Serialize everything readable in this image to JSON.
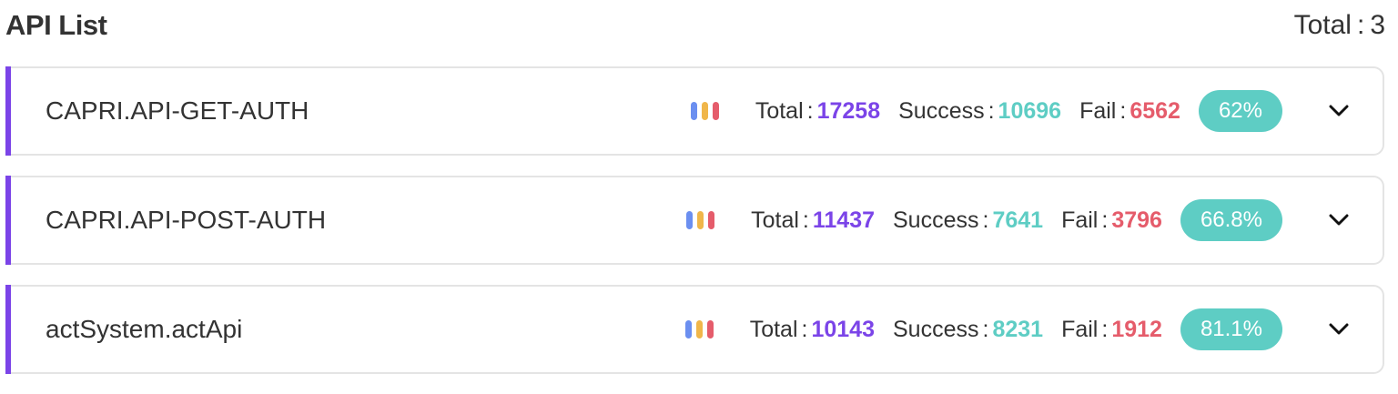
{
  "header": {
    "title": "API List",
    "total_label": "Total",
    "total_sep": ":",
    "total_value": "3"
  },
  "colors": {
    "accent": "#7b44e8",
    "success": "#5ecdc4",
    "fail": "#e55c6b",
    "bar_icon": [
      "#6b8ff0",
      "#f0b64a",
      "#e55c6b"
    ]
  },
  "labels": {
    "total": "Total",
    "success": "Success",
    "fail": "Fail",
    "sep": ":"
  },
  "apis": [
    {
      "name": "CAPRI.API-GET-AUTH",
      "total": "17258",
      "success": "10696",
      "fail": "6562",
      "rate": "62%"
    },
    {
      "name": "CAPRI.API-POST-AUTH",
      "total": "11437",
      "success": "7641",
      "fail": "3796",
      "rate": "66.8%"
    },
    {
      "name": "actSystem.actApi",
      "total": "10143",
      "success": "8231",
      "fail": "1912",
      "rate": "81.1%"
    }
  ]
}
